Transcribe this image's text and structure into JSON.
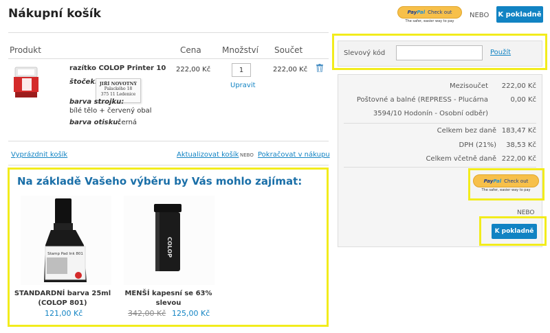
{
  "header": {
    "title": "Nákupní košík",
    "paypal": {
      "brand_a": "Pay",
      "brand_b": "Pal",
      "check_out": "Check out",
      "tagline": "The safer, easier way to pay"
    },
    "nebo": "NEBO",
    "checkout_label": "K pokladně"
  },
  "table": {
    "headers": {
      "product": "Produkt",
      "price": "Cena",
      "qty": "Množství",
      "total": "Součet"
    }
  },
  "item": {
    "name": "razítko COLOP Printer 10",
    "stocek_label": "štoček:",
    "stamp_lines": [
      "JIŘÍ NOVOTNÝ",
      "Palackého 18",
      "375 11 Ledenice"
    ],
    "body_color_label": "barva strojku:",
    "body_color_value": "bílé tělo + červený obal",
    "ink_color_label": "barva otisku:",
    "ink_color_value": "černá",
    "price": "222,00 Kč",
    "qty": "1",
    "update_label": "Upravit",
    "total": "222,00 Kč"
  },
  "cart_actions": {
    "empty": "Vyprázdnit košík",
    "update": "Aktualizovat košík",
    "nebo": "NEBO",
    "continue": "Pokračovat v nákupu"
  },
  "coupon": {
    "label": "Slevový kód",
    "value": "",
    "apply": "Použít"
  },
  "summary": {
    "subtotal_label": "Mezisoučet",
    "subtotal_value": "222,00 Kč",
    "shipping_label_1": "Poštovné a balné (REPRESS - Plucárna",
    "shipping_label_2": "3594/10 Hodonín - Osobní odběr)",
    "shipping_value": "0,00 Kč",
    "no_tax_label": "Celkem bez daně",
    "no_tax_value": "183,47 Kč",
    "vat_label": "DPH (21%)",
    "vat_value": "38,53 Kč",
    "total_label": "Celkem včetně daně",
    "total_value": "222,00 Kč",
    "nebo": "NEBO",
    "checkout_label": "K pokladně"
  },
  "recommendations": {
    "title": "Na základě Vašeho výběru by Vás mohlo zajímat:",
    "products": [
      {
        "name_1": "STANDARDNÍ barva 25ml",
        "name_2": "(COLOP 801)",
        "price": "121,00 Kč",
        "bottle_label": "Stamp Pad Ink 801"
      },
      {
        "name_1": "MENŠÍ kapesní se 63%",
        "name_2": "slevou",
        "old_price": "342,00 Kč",
        "price": "125,00 Kč",
        "brand": "COLOP"
      }
    ]
  },
  "colors": {
    "accent": "#1183c3",
    "highlight": "#f2ec1c",
    "paypal_yellow": "#f7c04a"
  }
}
